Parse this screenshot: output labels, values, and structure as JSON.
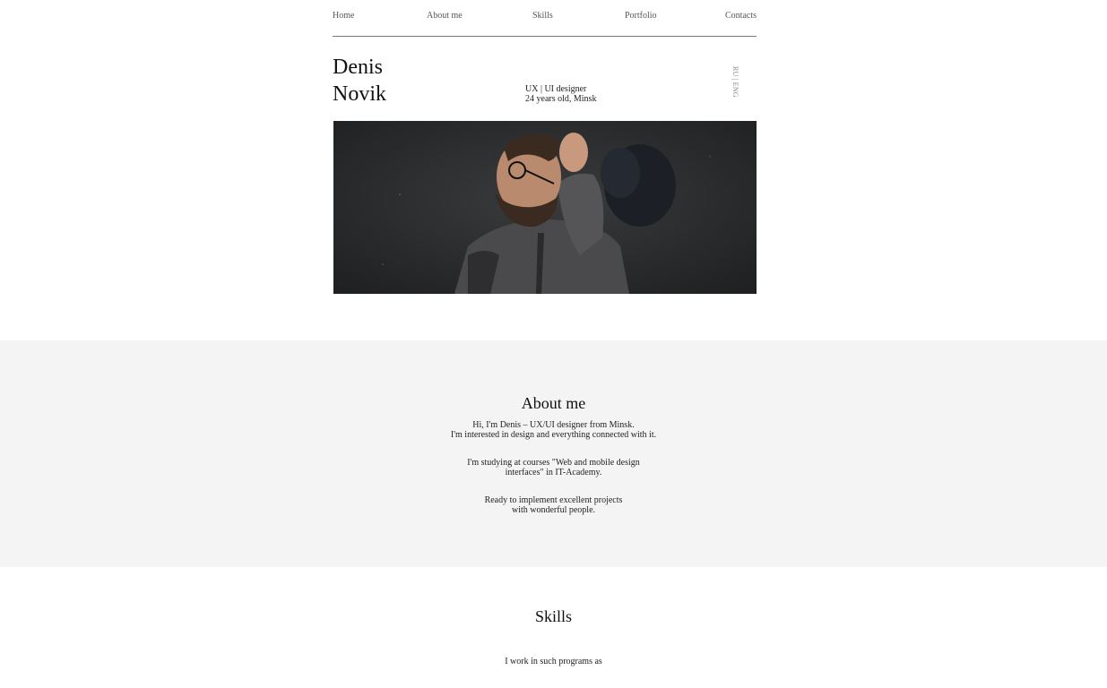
{
  "nav": {
    "items": [
      {
        "label": "Home"
      },
      {
        "label": "About me"
      },
      {
        "label": "Skills"
      },
      {
        "label": "Portfolio"
      },
      {
        "label": "Contacts"
      }
    ]
  },
  "hero": {
    "first_name": "Denis",
    "last_name": "Novik",
    "role": "UX | UI designer",
    "age_location": "24 years old, Minsk",
    "lang": {
      "ru": "RU",
      "separator": "|",
      "eng": "ENG"
    }
  },
  "about": {
    "title": "About me",
    "p1_line1": "Hi, I'm Denis – UX/UI designer from Minsk.",
    "p1_line2": "I'm interested in design and everything connected with it.",
    "p2_line1": "I'm studying at courses \"Web and mobile design",
    "p2_line2": "interfaces\" in IT-Academy.",
    "p3_line1": "Ready to implement excellent projects",
    "p3_line2": "with wonderful people."
  },
  "skills": {
    "title": "Skills",
    "intro": "I work in such programs as"
  }
}
